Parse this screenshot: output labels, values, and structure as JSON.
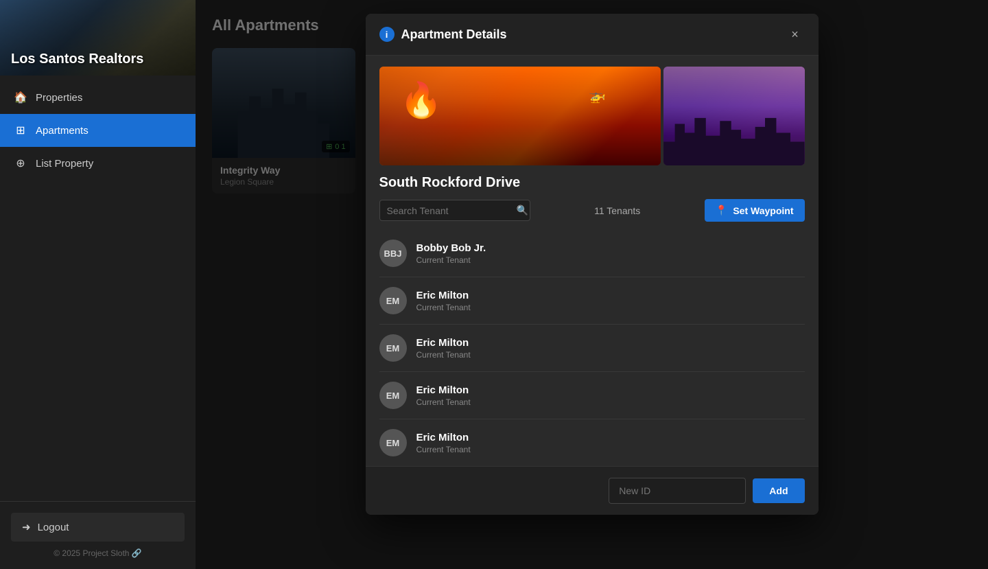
{
  "sidebar": {
    "logo_text": "Los Santos Realtors",
    "nav_items": [
      {
        "id": "properties",
        "label": "Properties",
        "icon": "🏠",
        "active": false
      },
      {
        "id": "apartments",
        "label": "Apartments",
        "icon": "⊞",
        "active": true
      },
      {
        "id": "list-property",
        "label": "List Property",
        "icon": "⊕",
        "active": false
      }
    ],
    "logout_label": "Logout",
    "copyright": "© 2025 Project Sloth 🔗"
  },
  "main": {
    "page_title": "All Apartments",
    "property_card": {
      "name": "Integrity Way",
      "location": "Legion Square",
      "badge": "0 1"
    }
  },
  "modal": {
    "title": "Apartment Details",
    "close_label": "×",
    "apartment_name": "South Rockford Drive",
    "tenant_count": "11 Tenants",
    "search_placeholder": "Search Tenant",
    "waypoint_label": "Set Waypoint",
    "tenants": [
      {
        "initials": "BBJ",
        "name": "Bobby Bob Jr.",
        "status": "Current Tenant"
      },
      {
        "initials": "EM",
        "name": "Eric Milton",
        "status": "Current Tenant"
      },
      {
        "initials": "EM",
        "name": "Eric Milton",
        "status": "Current Tenant"
      },
      {
        "initials": "EM",
        "name": "Eric Milton",
        "status": "Current Tenant"
      },
      {
        "initials": "EM",
        "name": "Eric Milton",
        "status": "Current Tenant"
      }
    ],
    "new_id_placeholder": "New ID",
    "add_label": "Add"
  }
}
